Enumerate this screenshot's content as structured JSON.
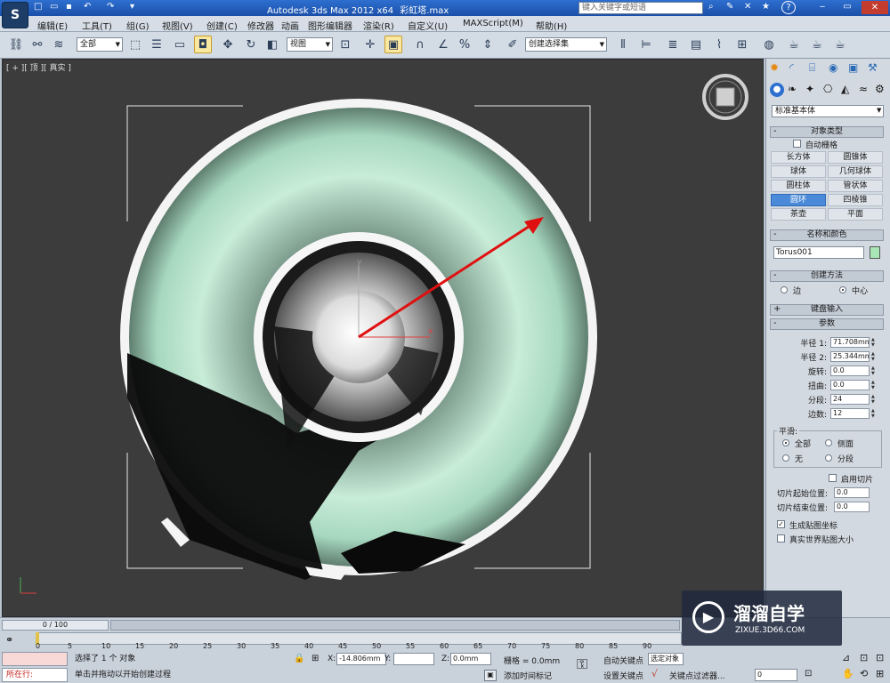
{
  "title_bar": {
    "app_title": "Autodesk 3ds Max  2012 x64",
    "file_name": "彩虹塔.max",
    "search_placeholder": "键入关键字或短语"
  },
  "menu": [
    "编辑(E)",
    "工具(T)",
    "组(G)",
    "视图(V)",
    "创建(C)",
    "修改器",
    "动画",
    "图形编辑器",
    "渲染(R)",
    "自定义(U)",
    "MAXScript(M)",
    "帮助(H)"
  ],
  "toolbar": {
    "selection_filter": "全部",
    "reference_coord": "视图",
    "named_selection": "创建选择集"
  },
  "viewport": {
    "label_plus": "+",
    "label_view": "顶",
    "label_shading": "真实",
    "axis_y": "y",
    "axis_x": "x"
  },
  "command_panel": {
    "category_dropdown": "标准基本体",
    "object_type_title": "对象类型",
    "autogrid_label": "自动栅格",
    "object_buttons": [
      "长方体",
      "圆锥体",
      "球体",
      "几何球体",
      "圆柱体",
      "管状体",
      "圆环",
      "四棱锥",
      "茶壶",
      "平面"
    ],
    "active_object": "圆环",
    "name_color_title": "名称和颜色",
    "object_name": "Torus001",
    "object_color": "#a8e6b8",
    "creation_method_title": "创建方法",
    "creation_edge": "边",
    "creation_center": "中心",
    "keyboard_input_title": "键盘输入",
    "parameters_title": "参数",
    "params": [
      {
        "label": "半径 1:",
        "value": "71.708mm"
      },
      {
        "label": "半径 2:",
        "value": "25.344mm"
      },
      {
        "label": "旋转:",
        "value": "0.0"
      },
      {
        "label": "扭曲:",
        "value": "0.0"
      },
      {
        "label": "分段:",
        "value": "24"
      },
      {
        "label": "边数:",
        "value": "12"
      }
    ],
    "smooth_title": "平滑:",
    "smooth_all": "全部",
    "smooth_side": "侧面",
    "smooth_none": "无",
    "smooth_segment": "分段",
    "slice_on": "启用切片",
    "slice_from_label": "切片起始位置:",
    "slice_from_value": "0.0",
    "slice_to_label": "切片结束位置:",
    "slice_to_value": "0.0",
    "gen_mapping": "生成贴图坐标",
    "real_world": "真实世界贴图大小"
  },
  "timeline": {
    "frame_counter": "0 / 100",
    "ticks": [
      "0",
      "5",
      "10",
      "15",
      "20",
      "25",
      "30",
      "35",
      "40",
      "45",
      "50",
      "55",
      "60",
      "65",
      "70",
      "75",
      "80",
      "85",
      "90"
    ],
    "status_selected": "选择了 1 个 对象",
    "status_prompt": "单击并拖动以开始创建过程",
    "mini_listener": "所在行:",
    "x_label": "X:",
    "x_value": "-14.806mm",
    "y_label": "Y:",
    "y_value": "",
    "z_label": "Z:",
    "z_value": "0.0mm",
    "grid_label": "栅格 = 0.0mm",
    "add_time_tag": "添加时间标记",
    "auto_key": "自动关键点",
    "selected_obj": "选定对象",
    "set_key": "设置关键点",
    "key_filters": "关键点过滤器...",
    "frame_value": "0"
  },
  "watermark": {
    "brand_cn": "溜溜自学",
    "brand_url": "ZIXUE.3D66.COM"
  }
}
